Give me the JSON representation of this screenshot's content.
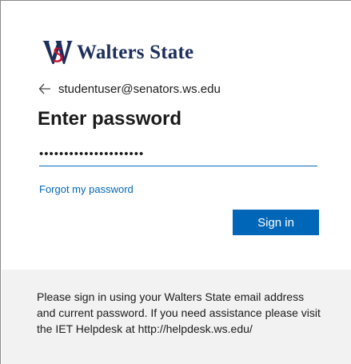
{
  "brand": {
    "logo_icon": "walters-state-ws-monogram",
    "name": "Walters State",
    "colors": {
      "navy": "#1d2f5c",
      "red": "#c8102e"
    }
  },
  "identity": {
    "back_icon": "arrow-left-icon",
    "email": "studentuser@senators.ws.edu"
  },
  "form": {
    "heading": "Enter password",
    "password_value": "•••••••••••••••••••••",
    "forgot_link": "Forgot my password",
    "signin_label": "Sign in",
    "accent_color": "#0067b8"
  },
  "footer": {
    "text": "Please sign in using your Walters State email address and current password. If you need assistance please visit the IET Helpdesk at http://helpdesk.ws.edu/"
  }
}
